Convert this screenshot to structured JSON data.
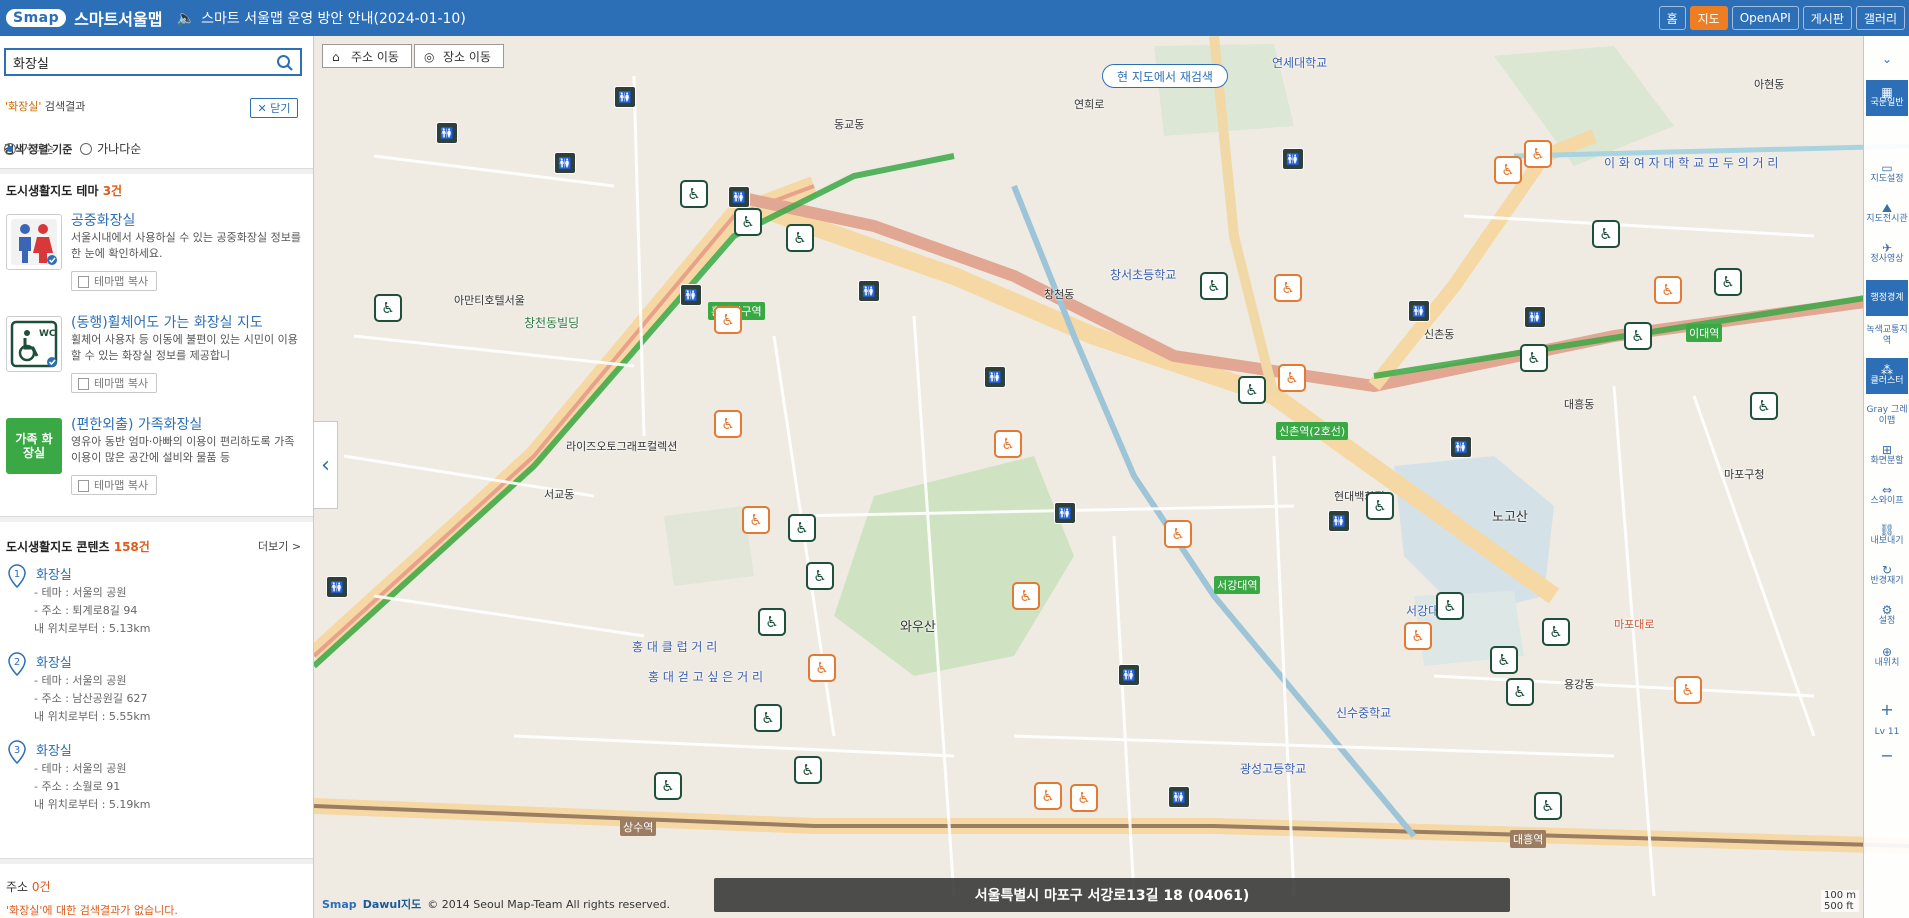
{
  "header": {
    "logo_mark": "Smap",
    "app_name": "스마트서울맵",
    "notice": "스마트 서울맵 운영 방안 안내(2024-01-10)",
    "nav": [
      "홈",
      "지도",
      "OpenAPI",
      "게시판",
      "갤러리"
    ],
    "active_nav": "지도"
  },
  "sidebar": {
    "search_value": "화장실",
    "result_query": "'화장실'",
    "result_suffix": " 검색결과",
    "close_label": "닫기",
    "sort_label": "검색 정렬 기준",
    "sort_options": [
      "거리순",
      "가나다순"
    ],
    "sort_selected": "거리순",
    "theme_section_label": "도시생활지도 테마",
    "theme_count": "3건",
    "themes": [
      {
        "title": "공중화장실",
        "desc": "서울시내에서 사용하실 수 있는 공중화장실 정보를 한 눈에 확인하세요.",
        "copy": "테마맵 복사",
        "icon": "public-toilet-icon"
      },
      {
        "title": "(동행)휠체어도 가는 화장실 지도",
        "desc": "휠체어 사용자 등 이동에 불편이 있는 시민이 이용할 수 있는 화장실 정보를 제공합니",
        "copy": "테마맵 복사",
        "icon": "wheelchair-toilet-icon"
      },
      {
        "title": "(편한외출) 가족화장실",
        "desc": "영유아 동반 엄마·아빠의 이용이 편리하도록 가족 이용이 많은 공간에 설비와 물품 등",
        "copy": "테마맵 복사",
        "icon": "family-toilet-icon",
        "icon_text": "가족 화장실"
      }
    ],
    "content_section_label": "도시생활지도 콘텐츠",
    "content_count": "158건",
    "more_label": "더보기 >",
    "results": [
      {
        "num": "1",
        "title": "화장실",
        "theme": "- 테마 : 서울의 공원",
        "addr": "- 주소 : 퇴계로8길 94",
        "dist": "내 위치로부터 : 5.13km"
      },
      {
        "num": "2",
        "title": "화장실",
        "theme": "- 테마 : 서울의 공원",
        "addr": "- 주소 : 남산공원길 627",
        "dist": "내 위치로부터 : 5.55km"
      },
      {
        "num": "3",
        "title": "화장실",
        "theme": "- 테마 : 서울의 공원",
        "addr": "- 주소 : 소월로 91",
        "dist": "내 위치로부터 : 5.19km"
      }
    ],
    "address_label": "주소",
    "address_count": "0건",
    "address_empty": "'화장실'에 대한 검색결과가 없습니다."
  },
  "map": {
    "buttons": [
      "주소 이동",
      "장소 이동"
    ],
    "research": "현 지도에서 재검색",
    "current_address": "서울특별시 마포구 서강로13길 18 (04061)",
    "copyright": "© 2014 Seoul Map-Team All rights reserved.",
    "copyright_logos": [
      "Smap",
      "Dawul지도"
    ],
    "zoom_level": "Lv 11",
    "scale": [
      "100 m",
      "500 ft"
    ],
    "toolbar": [
      {
        "label": "국문일반",
        "active": true
      },
      {
        "label": "지도설정"
      },
      {
        "label": "지도전시관"
      },
      {
        "label": "정사영상"
      },
      {
        "label": "행정경계",
        "active": true
      },
      {
        "label": "녹색교통지역"
      },
      {
        "label": "클러스터",
        "active": true
      },
      {
        "label": "Gray 그레이맵"
      },
      {
        "label": "화면분할"
      },
      {
        "label": "스와이프"
      },
      {
        "label": "내보내기"
      },
      {
        "label": "반경재기"
      },
      {
        "label": "설정"
      },
      {
        "label": "내위치"
      }
    ],
    "labels": {
      "l1": "창천동빌딩",
      "l2": "홍대입구역",
      "l3": "신촌역(2호선)",
      "l4": "이대역",
      "l5": "서강대역",
      "l6": "와우산",
      "l7": "노고산",
      "l8": "홍 대 클 럽 거 리",
      "l9": "서강대학교",
      "l10": "연세대학교",
      "l11": "창서초등학교",
      "l12": "신수중학교",
      "l13": "광성고등학교",
      "l14": "상수역",
      "l15": "대흥역",
      "l16": "아현동",
      "l17": "마포구청",
      "l18": "서교동",
      "l19": "동교동",
      "l20": "연희로",
      "l21": "라이즈오토그래프컬렉션",
      "l22": "아만티호텔서울",
      "l23": "홍 대 걷 고 싶 은 거 리",
      "l24": "이 화 여 자 대 학 교 모 두 의 거 리",
      "l25": "현대백화점",
      "l26": "대흥동",
      "l27": "용강동",
      "l28": "신촌동",
      "l29": "창천동",
      "l30": "마포대로"
    }
  }
}
